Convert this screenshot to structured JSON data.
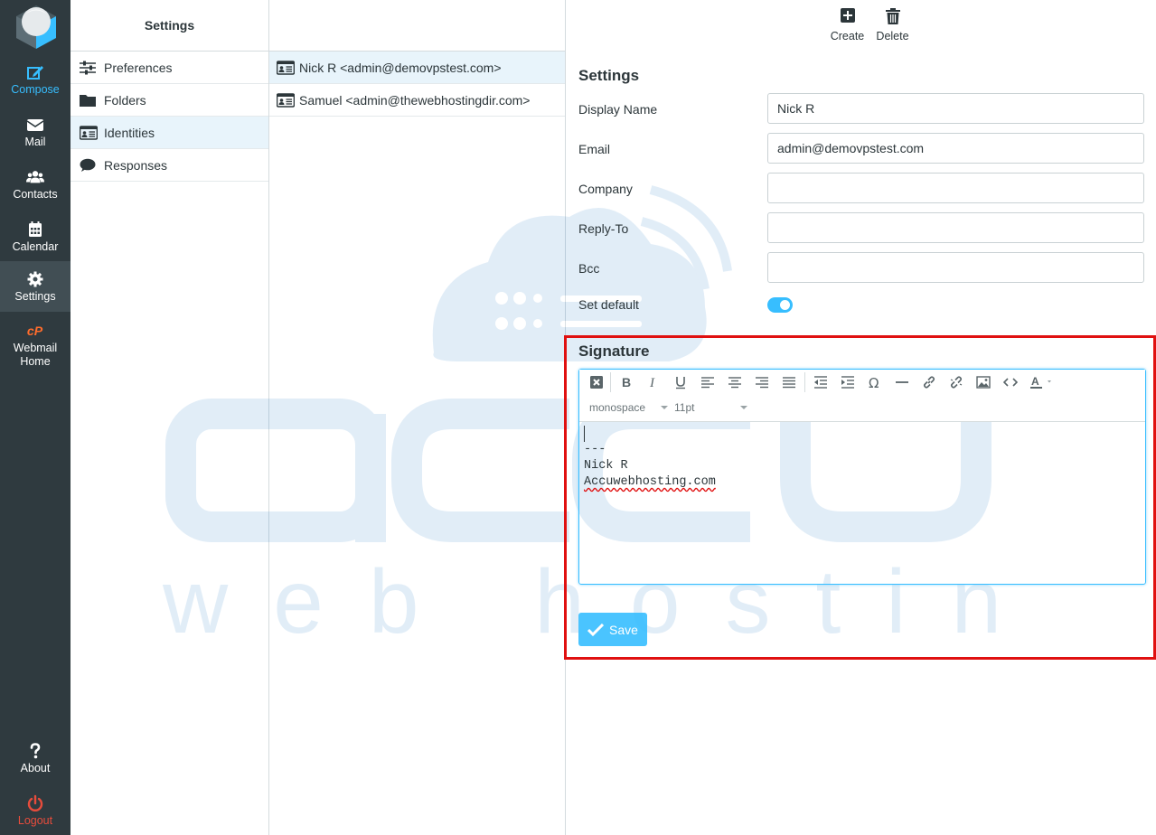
{
  "nav": {
    "items": [
      {
        "label": "Compose",
        "icon": "compose-icon"
      },
      {
        "label": "Mail",
        "icon": "envelope-icon"
      },
      {
        "label": "Contacts",
        "icon": "users-icon"
      },
      {
        "label": "Calendar",
        "icon": "calendar-icon"
      },
      {
        "label": "Settings",
        "icon": "gear-icon"
      },
      {
        "label": "Webmail Home",
        "icon": "cpanel-icon"
      }
    ],
    "bottom": [
      {
        "label": "About",
        "icon": "question-icon"
      },
      {
        "label": "Logout",
        "icon": "power-icon"
      }
    ],
    "accent": "#37beff",
    "logout_color": "#e74c3c"
  },
  "settings": {
    "title": "Settings",
    "items": [
      {
        "label": "Preferences",
        "icon": "sliders-icon"
      },
      {
        "label": "Folders",
        "icon": "folder-icon"
      },
      {
        "label": "Identities",
        "icon": "id-card-icon",
        "active": true
      },
      {
        "label": "Responses",
        "icon": "comment-icon"
      }
    ]
  },
  "identities": [
    {
      "label": "Nick R <admin@demovpstest.com>",
      "active": true
    },
    {
      "label": "Samuel <admin@thewebhostingdir.com>"
    }
  ],
  "toolbar": {
    "create_label": "Create",
    "delete_label": "Delete"
  },
  "form": {
    "section_title": "Settings",
    "display_name_label": "Display Name",
    "display_name_value": "Nick R",
    "email_label": "Email",
    "email_value": "admin@demovpstest.com",
    "company_label": "Company",
    "company_value": "",
    "reply_to_label": "Reply-To",
    "reply_to_value": "",
    "bcc_label": "Bcc",
    "bcc_value": "",
    "set_default_label": "Set default",
    "set_default_on": true
  },
  "signature": {
    "title": "Signature",
    "font_family": "monospace",
    "font_size": "11pt",
    "lines": [
      "",
      "---",
      "Nick R",
      "Accuwebhosting.com"
    ],
    "save_label": "Save"
  },
  "watermark": {
    "brand": "accu",
    "tagline": "web hosting"
  }
}
